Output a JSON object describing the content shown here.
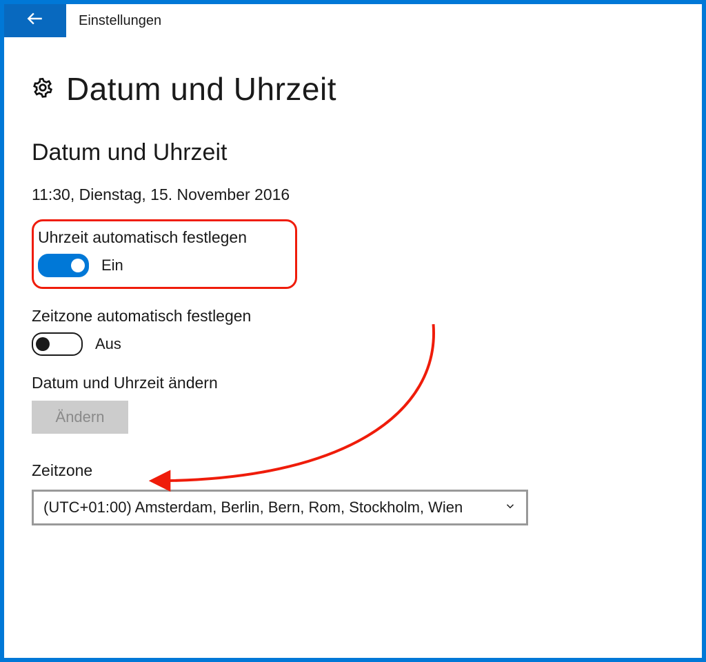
{
  "titlebar": {
    "app_name": "Einstellungen"
  },
  "page": {
    "title": "Datum und Uhrzeit",
    "section_title": "Datum und Uhrzeit",
    "current_datetime": "11:30, Dienstag, 15. November 2016"
  },
  "auto_time": {
    "label": "Uhrzeit automatisch festlegen",
    "state_text": "Ein",
    "on": true
  },
  "auto_tz": {
    "label": "Zeitzone automatisch festlegen",
    "state_text": "Aus",
    "on": false
  },
  "change_datetime": {
    "label": "Datum und Uhrzeit ändern",
    "button": "Ändern"
  },
  "timezone": {
    "label": "Zeitzone",
    "selected": "(UTC+01:00) Amsterdam, Berlin, Bern, Rom, Stockholm, Wien"
  },
  "annotation": {
    "color": "#ef1c0a"
  }
}
